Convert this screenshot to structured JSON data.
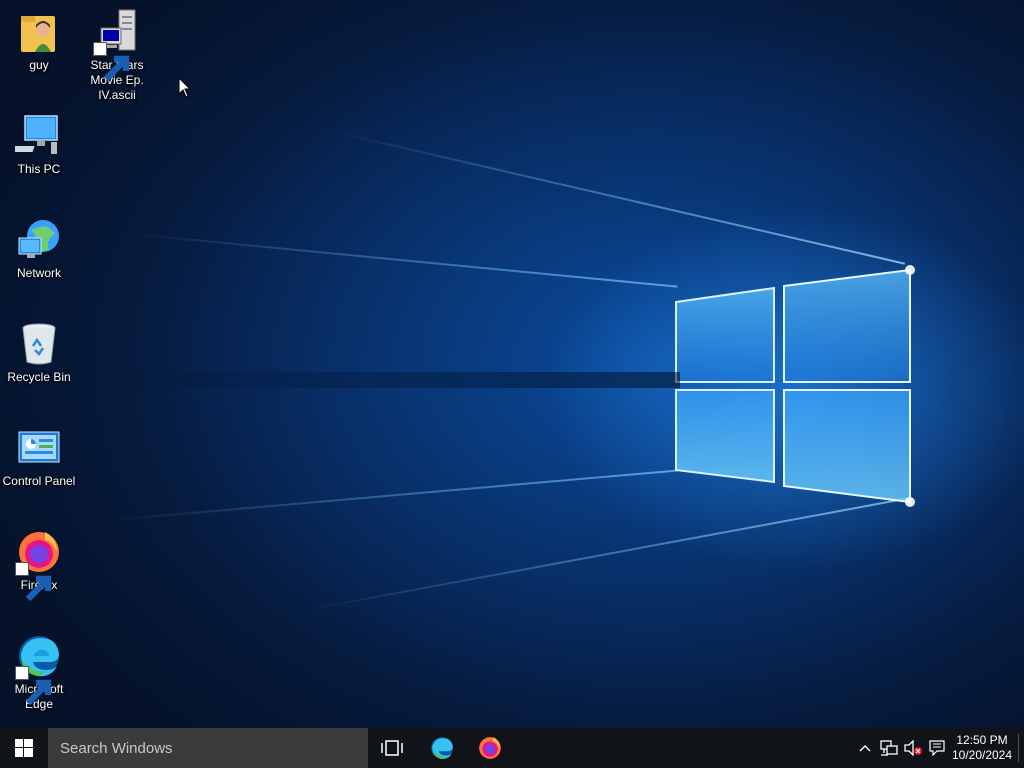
{
  "desktop": {
    "icons": [
      {
        "label": "guy",
        "icon": "user-folder-icon"
      },
      {
        "label": "Star Wars Movie Ep. IV.ascii",
        "icon": "remote-terminal-shortcut-icon"
      },
      {
        "label": "This PC",
        "icon": "computer-icon"
      },
      {
        "label": "Network",
        "icon": "network-globe-icon"
      },
      {
        "label": "Recycle Bin",
        "icon": "recycle-bin-icon"
      },
      {
        "label": "Control Panel",
        "icon": "control-panel-icon"
      },
      {
        "label": "Firefox",
        "icon": "firefox-icon"
      },
      {
        "label": "Microsoft Edge",
        "icon": "edge-icon"
      }
    ]
  },
  "taskbar": {
    "search_placeholder": "Search Windows",
    "pinned": [
      {
        "icon": "task-view-icon"
      },
      {
        "icon": "edge-icon"
      },
      {
        "icon": "firefox-icon"
      }
    ],
    "tray": {
      "time": "12:50 PM",
      "date": "10/20/2024",
      "icons": [
        "chevron-up-icon",
        "network-icon",
        "volume-muted-icon",
        "notification-icon"
      ]
    }
  },
  "colors": {
    "taskbar": "#101418",
    "search_box": "#3b3b3b",
    "wallpaper_glow": "#2896ff"
  }
}
